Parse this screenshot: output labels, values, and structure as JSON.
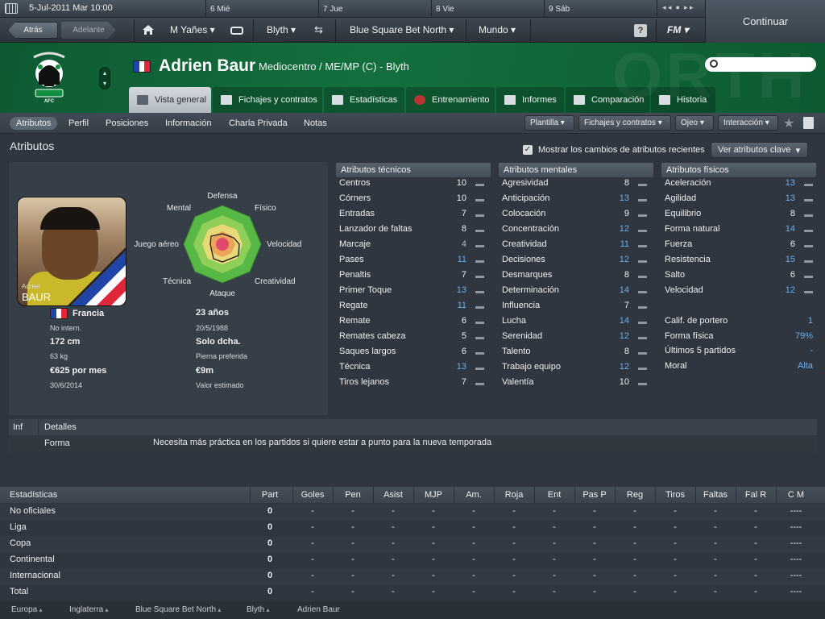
{
  "calendar": {
    "current_date": "5-Jul-2011 Mar  10:00",
    "days": [
      "6 Mié",
      "7 Jue",
      "8 Vie",
      "9 Sáb"
    ]
  },
  "nav": {
    "back": "Atrás",
    "forward": "Adelante",
    "manager": "M Yañes",
    "club": "Blyth",
    "league": "Blue Square Bet North",
    "world": "Mundo",
    "help": "?",
    "fm": "FM"
  },
  "continue_label": "Continuar",
  "header": {
    "bg_text": "ORTH",
    "player_name": "Adrien Baur",
    "player_role": "Mediocentro / ME/MP (C) - Blyth"
  },
  "tabs": [
    "Vista general",
    "Fichajes y contratos",
    "Estadísticas",
    "Entrenamiento",
    "Informes",
    "Comparación",
    "Historia"
  ],
  "subnav": {
    "items": [
      "Atributos",
      "Perfil",
      "Posiciones",
      "Información",
      "Charla Privada",
      "Notas"
    ],
    "dropdowns": [
      "Plantilla",
      "Fichajes y contratos",
      "Ojeo",
      "Interacción"
    ]
  },
  "section_title": "Atributos",
  "show_changes_label": "Mostrar los cambios de atributos recientes",
  "key_attr_button": "Ver atributos clave",
  "polar_labels": [
    "Defensa",
    "Físico",
    "Velocidad",
    "Creatividad",
    "Ataque",
    "Técnica",
    "Juego aéreo",
    "Mental"
  ],
  "photo": {
    "first": "Adrien",
    "last": "BAUR"
  },
  "profile": {
    "nationality": "Francia",
    "caps": "No intern.",
    "age": "23 años",
    "dob": "20/5/1988",
    "height": "172 cm",
    "foot": "Solo dcha.",
    "weight": "63 kg",
    "foot_label": "Pierna preferida",
    "wage": "€625 por mes",
    "value": "€9m",
    "contract_end": "30/6/2014",
    "value_label": "Valor estimado"
  },
  "technical": {
    "title": "Atributos técnicos",
    "rows": [
      {
        "name": "Centros",
        "value": "10",
        "style": "w"
      },
      {
        "name": "Córners",
        "value": "10",
        "style": "w"
      },
      {
        "name": "Entradas",
        "value": "7",
        "style": "w"
      },
      {
        "name": "Lanzador de faltas",
        "value": "8",
        "style": "w"
      },
      {
        "name": "Marcaje",
        "value": "4",
        "style": "g"
      },
      {
        "name": "Pases",
        "value": "11",
        "style": "b"
      },
      {
        "name": "Penaltis",
        "value": "7",
        "style": "w"
      },
      {
        "name": "Primer Toque",
        "value": "13",
        "style": "b"
      },
      {
        "name": "Regate",
        "value": "11",
        "style": "b"
      },
      {
        "name": "Remate",
        "value": "6",
        "style": "w"
      },
      {
        "name": "Remates cabeza",
        "value": "5",
        "style": "w"
      },
      {
        "name": "Saques largos",
        "value": "6",
        "style": "w"
      },
      {
        "name": "Técnica",
        "value": "13",
        "style": "b"
      },
      {
        "name": "Tiros lejanos",
        "value": "7",
        "style": "w"
      }
    ]
  },
  "mental": {
    "title": "Atributos mentales",
    "rows": [
      {
        "name": "Agresividad",
        "value": "8",
        "style": "w"
      },
      {
        "name": "Anticipación",
        "value": "13",
        "style": "b"
      },
      {
        "name": "Colocación",
        "value": "9",
        "style": "w"
      },
      {
        "name": "Concentración",
        "value": "12",
        "style": "b"
      },
      {
        "name": "Creatividad",
        "value": "11",
        "style": "b"
      },
      {
        "name": "Decisiones",
        "value": "12",
        "style": "b"
      },
      {
        "name": "Desmarques",
        "value": "8",
        "style": "w"
      },
      {
        "name": "Determinación",
        "value": "14",
        "style": "b"
      },
      {
        "name": "Influencia",
        "value": "7",
        "style": "w"
      },
      {
        "name": "Lucha",
        "value": "14",
        "style": "b"
      },
      {
        "name": "Serenidad",
        "value": "12",
        "style": "b"
      },
      {
        "name": "Talento",
        "value": "8",
        "style": "w"
      },
      {
        "name": "Trabajo equipo",
        "value": "12",
        "style": "b"
      },
      {
        "name": "Valentía",
        "value": "10",
        "style": "w"
      }
    ]
  },
  "physical": {
    "title": "Atributos físicos",
    "rows": [
      {
        "name": "Aceleración",
        "value": "13",
        "style": "b"
      },
      {
        "name": "Agilidad",
        "value": "13",
        "style": "b"
      },
      {
        "name": "Equilibrio",
        "value": "8",
        "style": "w"
      },
      {
        "name": "Forma natural",
        "value": "14",
        "style": "b"
      },
      {
        "name": "Fuerza",
        "value": "6",
        "style": "w"
      },
      {
        "name": "Resistencia",
        "value": "15",
        "style": "b"
      },
      {
        "name": "Salto",
        "value": "6",
        "style": "w"
      },
      {
        "name": "Velocidad",
        "value": "12",
        "style": "b"
      }
    ],
    "extra": [
      {
        "name": "Calif. de portero",
        "value": "1",
        "style": "b"
      },
      {
        "name": "Forma física",
        "value": "79%",
        "style": "b"
      },
      {
        "name": "Últimos 5 partidos",
        "value": "-",
        "style": "b"
      },
      {
        "name": "Moral",
        "value": "Alta",
        "style": "b"
      }
    ]
  },
  "info_table": {
    "col1": "Inf",
    "col2": "Detalles",
    "row_label": "Forma",
    "row_text": "Necesita más práctica en los partidos si quiere estar a punto para la nueva temporada"
  },
  "stats": {
    "title": "Estadísticas",
    "headers": [
      "Part",
      "Goles",
      "Pen",
      "Asist",
      "MJP",
      "Am.",
      "Roja",
      "Ent",
      "Pas P",
      "Reg",
      "Tiros",
      "Faltas",
      "Fal R",
      "C M"
    ],
    "rows": [
      {
        "label": "No oficiales",
        "part": "0",
        "rest": "-",
        "last": "----"
      },
      {
        "label": "Liga",
        "part": "0",
        "rest": "-",
        "last": "----"
      },
      {
        "label": "Copa",
        "part": "0",
        "rest": "-",
        "last": "----"
      },
      {
        "label": "Continental",
        "part": "0",
        "rest": "-",
        "last": "----"
      },
      {
        "label": "Internacional",
        "part": "0",
        "rest": "-",
        "last": "----"
      },
      {
        "label": "Total",
        "part": "0",
        "rest": "-",
        "last": "----"
      }
    ]
  },
  "breadcrumbs": [
    "Europa",
    "Inglaterra",
    "Blue Square Bet North",
    "Blyth",
    "Adrien Baur"
  ],
  "colors": {
    "header_green": "#13703e",
    "value_blue": "#6cb0ef",
    "bg": "#2f3640"
  }
}
